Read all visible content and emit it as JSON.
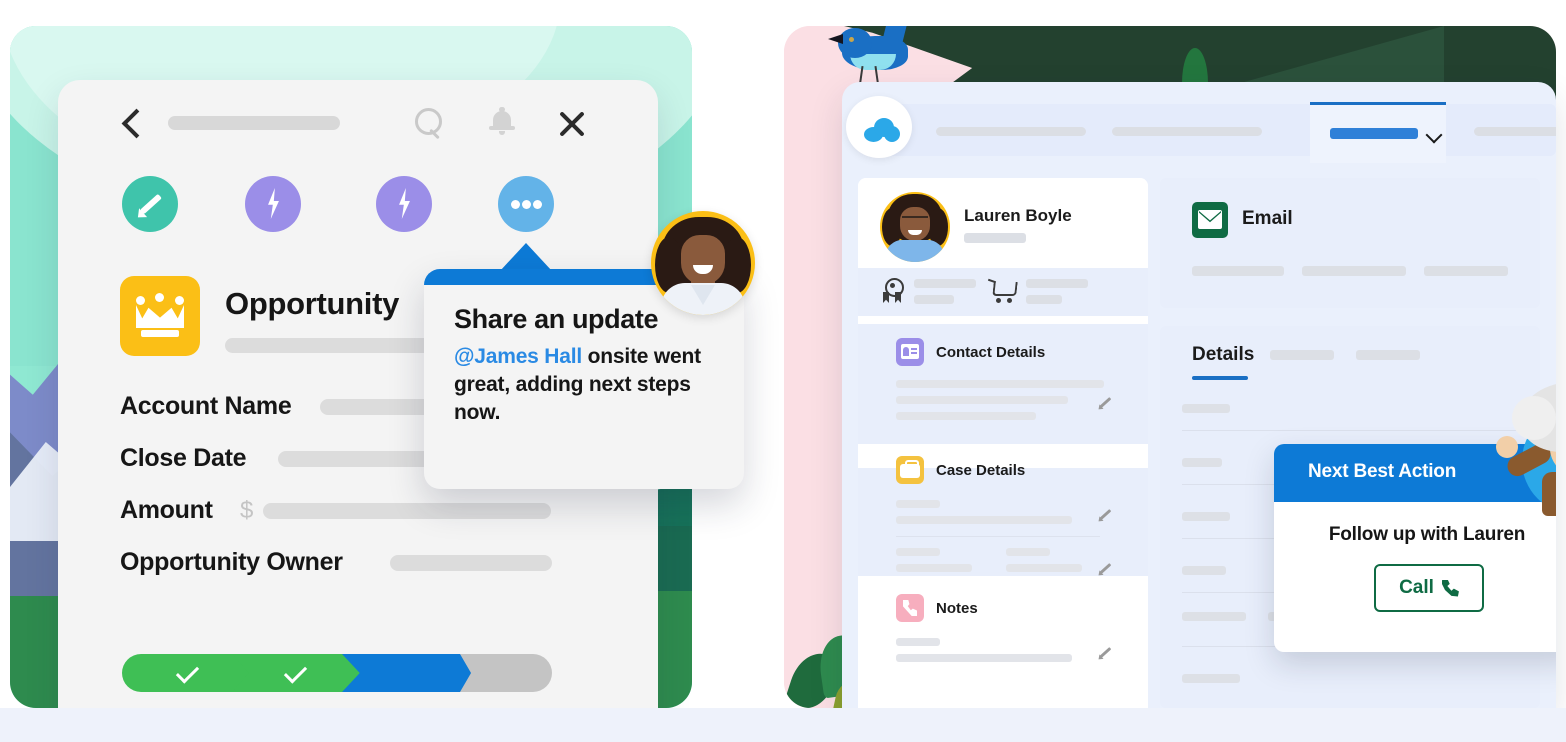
{
  "left_panel": {
    "header": {
      "back_icon": "chevron-left-icon",
      "search_icon": "search-icon",
      "bell_icon": "notification-bell-icon",
      "close_icon": "close-icon"
    },
    "quick_actions": [
      {
        "name": "edit-action",
        "icon": "pencil-icon",
        "color": "#3fc4ab"
      },
      {
        "name": "flow-action-1",
        "icon": "lightning-bolt-icon",
        "color": "#9b8ee8"
      },
      {
        "name": "flow-action-2",
        "icon": "lightning-bolt-icon",
        "color": "#9b8ee8"
      },
      {
        "name": "more-action",
        "icon": "ellipsis-icon",
        "color": "#63b3e8"
      }
    ],
    "record": {
      "icon": "crown-icon",
      "icon_color": "#fbbf16",
      "type_label": "Opportunity",
      "fields": [
        {
          "label": "Account Name"
        },
        {
          "label": "Close Date"
        },
        {
          "label": "Amount",
          "prefix": "$"
        },
        {
          "label": "Opportunity Owner"
        }
      ]
    },
    "sales_path": {
      "stages": [
        {
          "state": "complete",
          "color": "#3fbf55",
          "icon": "check-icon"
        },
        {
          "state": "complete",
          "color": "#3fbf55",
          "icon": "check-icon"
        },
        {
          "state": "current",
          "color": "#0d7ad6"
        },
        {
          "state": "upcoming",
          "color": "#c4c4c4"
        }
      ]
    },
    "bubble": {
      "title": "Share an update",
      "mention": "@James Hall",
      "body_rest": " onsite went great, adding next steps now.",
      "accent": "#0d7ad6"
    }
  },
  "right_panel": {
    "decor": {
      "bird_icon": "bluebird-icon",
      "pink_bg": "#fbdfe4",
      "dark_green": "#23412f"
    },
    "nav": {
      "logo_icon": "salesforce-cloud-icon",
      "active_tab_accent": "#1a6fc4",
      "chevron_icon": "chevron-down-icon"
    },
    "contact": {
      "avatar_icon": "user-avatar",
      "name": "Lauren Boyle",
      "meta_icons": [
        "badge-icon",
        "shopping-cart-icon"
      ]
    },
    "sections": [
      {
        "title": "Contact Details",
        "icon": "id-card-icon",
        "icon_color": "#9b8ee8"
      },
      {
        "title": "Case Details",
        "icon": "briefcase-icon",
        "icon_color": "#f4c23f"
      },
      {
        "title": "Notes",
        "icon": "phone-icon",
        "icon_color": "#f7aebe"
      }
    ],
    "email_card": {
      "title": "Email",
      "icon": "envelope-icon",
      "icon_color": "#0f6b44"
    },
    "details_card": {
      "title": "Details",
      "underline_color": "#1a6fc4",
      "edit_icon": "pencil-icon"
    },
    "next_best_action": {
      "header": "Next Best Action",
      "header_color": "#0d7ad6",
      "message": "Follow up with Lauren",
      "button_label": "Call",
      "button_icon": "phone-icon",
      "button_color": "#0f6b44",
      "mascot_icon": "einstein-mascot"
    }
  }
}
